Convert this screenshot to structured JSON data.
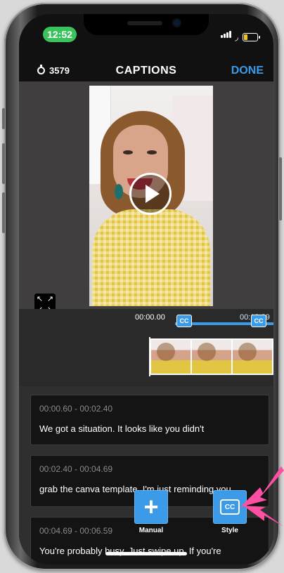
{
  "status_bar": {
    "time": "12:52"
  },
  "header": {
    "counter": "3579",
    "title": "CAPTIONS",
    "done_label": "DONE"
  },
  "timeline": {
    "start_time": "00:00.00",
    "end_time": "00:13.89",
    "marker_label": "CC"
  },
  "captions": [
    {
      "time": "00:00.60 - 00:02.40",
      "text": "We got a situation. It looks like you didn't"
    },
    {
      "time": "00:02.40 - 00:04.69",
      "text": "grab the canva template. I'm just reminding you."
    },
    {
      "time": "00:04.69 - 00:06.59",
      "text": "You're probably busy. Just swipe up. If you're"
    }
  ],
  "actions": {
    "manual_label": "Manual",
    "style_label": "Style",
    "style_icon_text": "CC"
  },
  "colors": {
    "accent": "#3b9be8",
    "status_green": "#3ac35c",
    "highlight_arrow": "#ff4fa3"
  }
}
